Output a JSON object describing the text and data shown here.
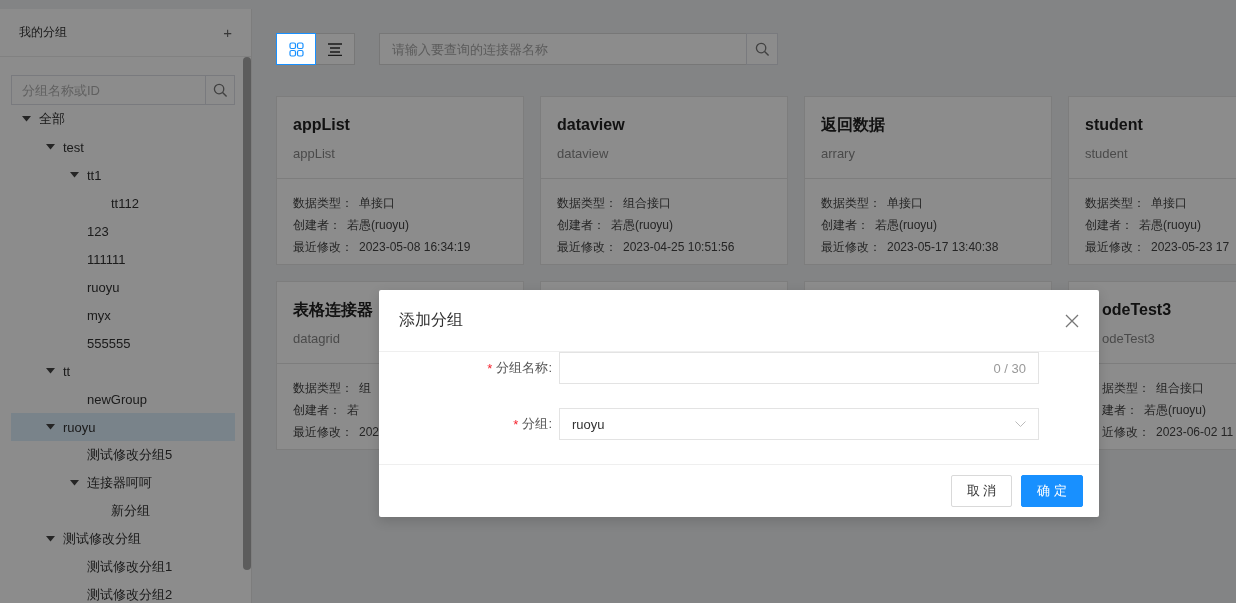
{
  "sidebar": {
    "title": "我的分组",
    "add_label": "+",
    "search": {
      "placeholder": "分组名称或ID"
    },
    "tree": [
      {
        "label": "全部",
        "selected": false,
        "expanded": true,
        "children": [
          {
            "label": "test",
            "selected": false,
            "expanded": true,
            "children": [
              {
                "label": "tt1",
                "selected": false,
                "expanded": true,
                "children": [
                  {
                    "label": "tt112",
                    "selected": false
                  }
                ]
              },
              {
                "label": "123",
                "selected": false
              },
              {
                "label": "111111",
                "selected": false
              },
              {
                "label": "ruoyu",
                "selected": false
              },
              {
                "label": "myx",
                "selected": false
              },
              {
                "label": "555555",
                "selected": false
              }
            ]
          },
          {
            "label": "tt",
            "selected": false,
            "expanded": true,
            "children": [
              {
                "label": "newGroup",
                "selected": false
              }
            ]
          },
          {
            "label": "ruoyu",
            "selected": true,
            "expanded": true,
            "children": [
              {
                "label": "测试修改分组5",
                "selected": false
              },
              {
                "label": "连接器呵呵",
                "selected": false,
                "expanded": true,
                "children": [
                  {
                    "label": "新分组",
                    "selected": false
                  }
                ]
              }
            ]
          },
          {
            "label": "测试修改分组",
            "selected": false,
            "expanded": true,
            "children": [
              {
                "label": "测试修改分组1",
                "selected": false
              },
              {
                "label": "测试修改分组2",
                "selected": false
              }
            ]
          }
        ]
      }
    ]
  },
  "toolbar": {
    "views": [
      {
        "kind": "grid",
        "selected": true
      },
      {
        "kind": "list",
        "selected": false
      }
    ],
    "search": {
      "placeholder": "请输入要查询的连接器名称"
    }
  },
  "card_rows": [
    [
      {
        "kind": "full",
        "title": "appList",
        "subtitle": "appList",
        "fields": [
          {
            "label": "数据类型：",
            "value": "单接口"
          },
          {
            "label": "创建者：",
            "value": "若愚(ruoyu)"
          },
          {
            "label": "最近修改：",
            "value": "2023-05-08 16:34:19"
          }
        ]
      },
      {
        "kind": "full",
        "title": "dataview",
        "subtitle": "dataview",
        "fields": [
          {
            "label": "数据类型：",
            "value": "组合接口"
          },
          {
            "label": "创建者：",
            "value": "若愚(ruoyu)"
          },
          {
            "label": "最近修改：",
            "value": "2023-04-25 10:51:56"
          }
        ]
      },
      {
        "kind": "full",
        "title": "返回数据",
        "subtitle": "arrary",
        "fields": [
          {
            "label": "数据类型：",
            "value": "单接口"
          },
          {
            "label": "创建者：",
            "value": "若愚(ruoyu)"
          },
          {
            "label": "最近修改：",
            "value": "2023-05-17 13:40:38"
          }
        ]
      },
      {
        "kind": "full",
        "title": "student",
        "subtitle": "student",
        "fields": [
          {
            "label": "数据类型：",
            "value": "单接口"
          },
          {
            "label": "创建者：",
            "value": "若愚(ruoyu)"
          },
          {
            "label": "最近修改：",
            "value": "2023-05-23 17"
          }
        ]
      }
    ],
    [
      {
        "kind": "full",
        "title": "表格连接器",
        "subtitle": "datagrid",
        "fields": [
          {
            "label": "数据类型：",
            "value": "组"
          },
          {
            "label": "创建者：",
            "value": "若"
          },
          {
            "label": "最近修改：",
            "value": "202"
          }
        ]
      },
      {
        "kind": "covered"
      },
      {
        "kind": "covered"
      },
      {
        "kind": "left-cut",
        "title": "odeTest3",
        "subtitle": "odeTest3",
        "fields": [
          {
            "label": "据类型：",
            "value": "组合接口"
          },
          {
            "label": "建者：",
            "value": "若愚(ruoyu)"
          },
          {
            "label": "近修改：",
            "value": "2023-06-02 11"
          }
        ]
      }
    ]
  ],
  "dialog": {
    "title": "添加分组",
    "fields": [
      {
        "kind": "text",
        "required_mark": "*",
        "label": "分组名称:",
        "counter": "0 / 30"
      },
      {
        "kind": "select",
        "required_mark": "*",
        "label": "分组:",
        "value": "ruoyu"
      }
    ],
    "buttons": [
      {
        "label": "取 消",
        "kind": "default"
      },
      {
        "label": "确 定",
        "kind": "primary"
      }
    ]
  }
}
